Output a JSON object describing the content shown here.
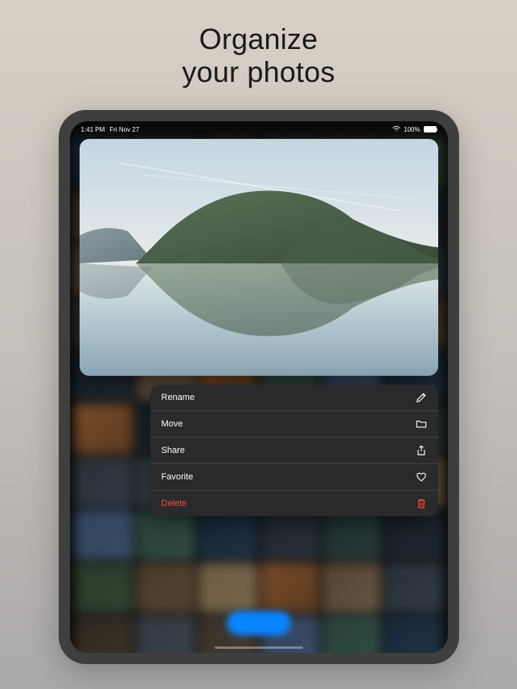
{
  "headline": {
    "line1": "Organize",
    "line2": "your photos"
  },
  "statusbar": {
    "time": "1:41 PM",
    "date": "Fri Nov 27",
    "battery": "100%"
  },
  "menu": {
    "rename": "Rename",
    "move": "Move",
    "share": "Share",
    "favorite": "Favorite",
    "delete": "Delete"
  },
  "colors": {
    "accent": "#0a84ff",
    "danger": "#ff453a",
    "menu_bg": "#2a2a2c"
  }
}
